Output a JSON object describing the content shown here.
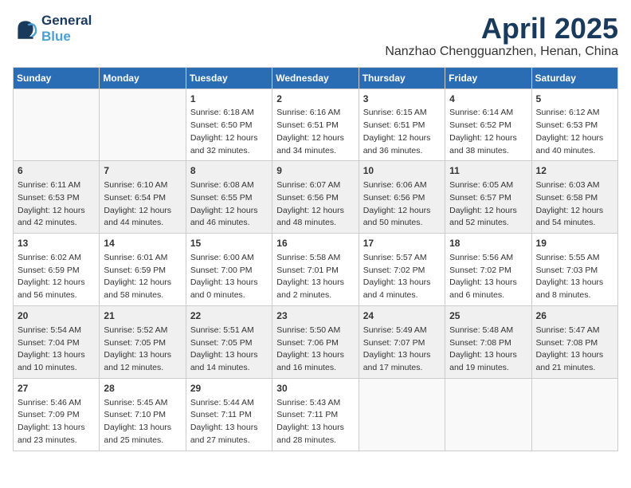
{
  "header": {
    "logo_line1": "General",
    "logo_line2": "Blue",
    "month_title": "April 2025",
    "location": "Nanzhao Chengguanzhen, Henan, China"
  },
  "weekdays": [
    "Sunday",
    "Monday",
    "Tuesday",
    "Wednesday",
    "Thursday",
    "Friday",
    "Saturday"
  ],
  "weeks": [
    [
      {
        "day": "",
        "info": ""
      },
      {
        "day": "",
        "info": ""
      },
      {
        "day": "1",
        "info": "Sunrise: 6:18 AM\nSunset: 6:50 PM\nDaylight: 12 hours\nand 32 minutes."
      },
      {
        "day": "2",
        "info": "Sunrise: 6:16 AM\nSunset: 6:51 PM\nDaylight: 12 hours\nand 34 minutes."
      },
      {
        "day": "3",
        "info": "Sunrise: 6:15 AM\nSunset: 6:51 PM\nDaylight: 12 hours\nand 36 minutes."
      },
      {
        "day": "4",
        "info": "Sunrise: 6:14 AM\nSunset: 6:52 PM\nDaylight: 12 hours\nand 38 minutes."
      },
      {
        "day": "5",
        "info": "Sunrise: 6:12 AM\nSunset: 6:53 PM\nDaylight: 12 hours\nand 40 minutes."
      }
    ],
    [
      {
        "day": "6",
        "info": "Sunrise: 6:11 AM\nSunset: 6:53 PM\nDaylight: 12 hours\nand 42 minutes."
      },
      {
        "day": "7",
        "info": "Sunrise: 6:10 AM\nSunset: 6:54 PM\nDaylight: 12 hours\nand 44 minutes."
      },
      {
        "day": "8",
        "info": "Sunrise: 6:08 AM\nSunset: 6:55 PM\nDaylight: 12 hours\nand 46 minutes."
      },
      {
        "day": "9",
        "info": "Sunrise: 6:07 AM\nSunset: 6:56 PM\nDaylight: 12 hours\nand 48 minutes."
      },
      {
        "day": "10",
        "info": "Sunrise: 6:06 AM\nSunset: 6:56 PM\nDaylight: 12 hours\nand 50 minutes."
      },
      {
        "day": "11",
        "info": "Sunrise: 6:05 AM\nSunset: 6:57 PM\nDaylight: 12 hours\nand 52 minutes."
      },
      {
        "day": "12",
        "info": "Sunrise: 6:03 AM\nSunset: 6:58 PM\nDaylight: 12 hours\nand 54 minutes."
      }
    ],
    [
      {
        "day": "13",
        "info": "Sunrise: 6:02 AM\nSunset: 6:59 PM\nDaylight: 12 hours\nand 56 minutes."
      },
      {
        "day": "14",
        "info": "Sunrise: 6:01 AM\nSunset: 6:59 PM\nDaylight: 12 hours\nand 58 minutes."
      },
      {
        "day": "15",
        "info": "Sunrise: 6:00 AM\nSunset: 7:00 PM\nDaylight: 13 hours\nand 0 minutes."
      },
      {
        "day": "16",
        "info": "Sunrise: 5:58 AM\nSunset: 7:01 PM\nDaylight: 13 hours\nand 2 minutes."
      },
      {
        "day": "17",
        "info": "Sunrise: 5:57 AM\nSunset: 7:02 PM\nDaylight: 13 hours\nand 4 minutes."
      },
      {
        "day": "18",
        "info": "Sunrise: 5:56 AM\nSunset: 7:02 PM\nDaylight: 13 hours\nand 6 minutes."
      },
      {
        "day": "19",
        "info": "Sunrise: 5:55 AM\nSunset: 7:03 PM\nDaylight: 13 hours\nand 8 minutes."
      }
    ],
    [
      {
        "day": "20",
        "info": "Sunrise: 5:54 AM\nSunset: 7:04 PM\nDaylight: 13 hours\nand 10 minutes."
      },
      {
        "day": "21",
        "info": "Sunrise: 5:52 AM\nSunset: 7:05 PM\nDaylight: 13 hours\nand 12 minutes."
      },
      {
        "day": "22",
        "info": "Sunrise: 5:51 AM\nSunset: 7:05 PM\nDaylight: 13 hours\nand 14 minutes."
      },
      {
        "day": "23",
        "info": "Sunrise: 5:50 AM\nSunset: 7:06 PM\nDaylight: 13 hours\nand 16 minutes."
      },
      {
        "day": "24",
        "info": "Sunrise: 5:49 AM\nSunset: 7:07 PM\nDaylight: 13 hours\nand 17 minutes."
      },
      {
        "day": "25",
        "info": "Sunrise: 5:48 AM\nSunset: 7:08 PM\nDaylight: 13 hours\nand 19 minutes."
      },
      {
        "day": "26",
        "info": "Sunrise: 5:47 AM\nSunset: 7:08 PM\nDaylight: 13 hours\nand 21 minutes."
      }
    ],
    [
      {
        "day": "27",
        "info": "Sunrise: 5:46 AM\nSunset: 7:09 PM\nDaylight: 13 hours\nand 23 minutes."
      },
      {
        "day": "28",
        "info": "Sunrise: 5:45 AM\nSunset: 7:10 PM\nDaylight: 13 hours\nand 25 minutes."
      },
      {
        "day": "29",
        "info": "Sunrise: 5:44 AM\nSunset: 7:11 PM\nDaylight: 13 hours\nand 27 minutes."
      },
      {
        "day": "30",
        "info": "Sunrise: 5:43 AM\nSunset: 7:11 PM\nDaylight: 13 hours\nand 28 minutes."
      },
      {
        "day": "",
        "info": ""
      },
      {
        "day": "",
        "info": ""
      },
      {
        "day": "",
        "info": ""
      }
    ]
  ]
}
